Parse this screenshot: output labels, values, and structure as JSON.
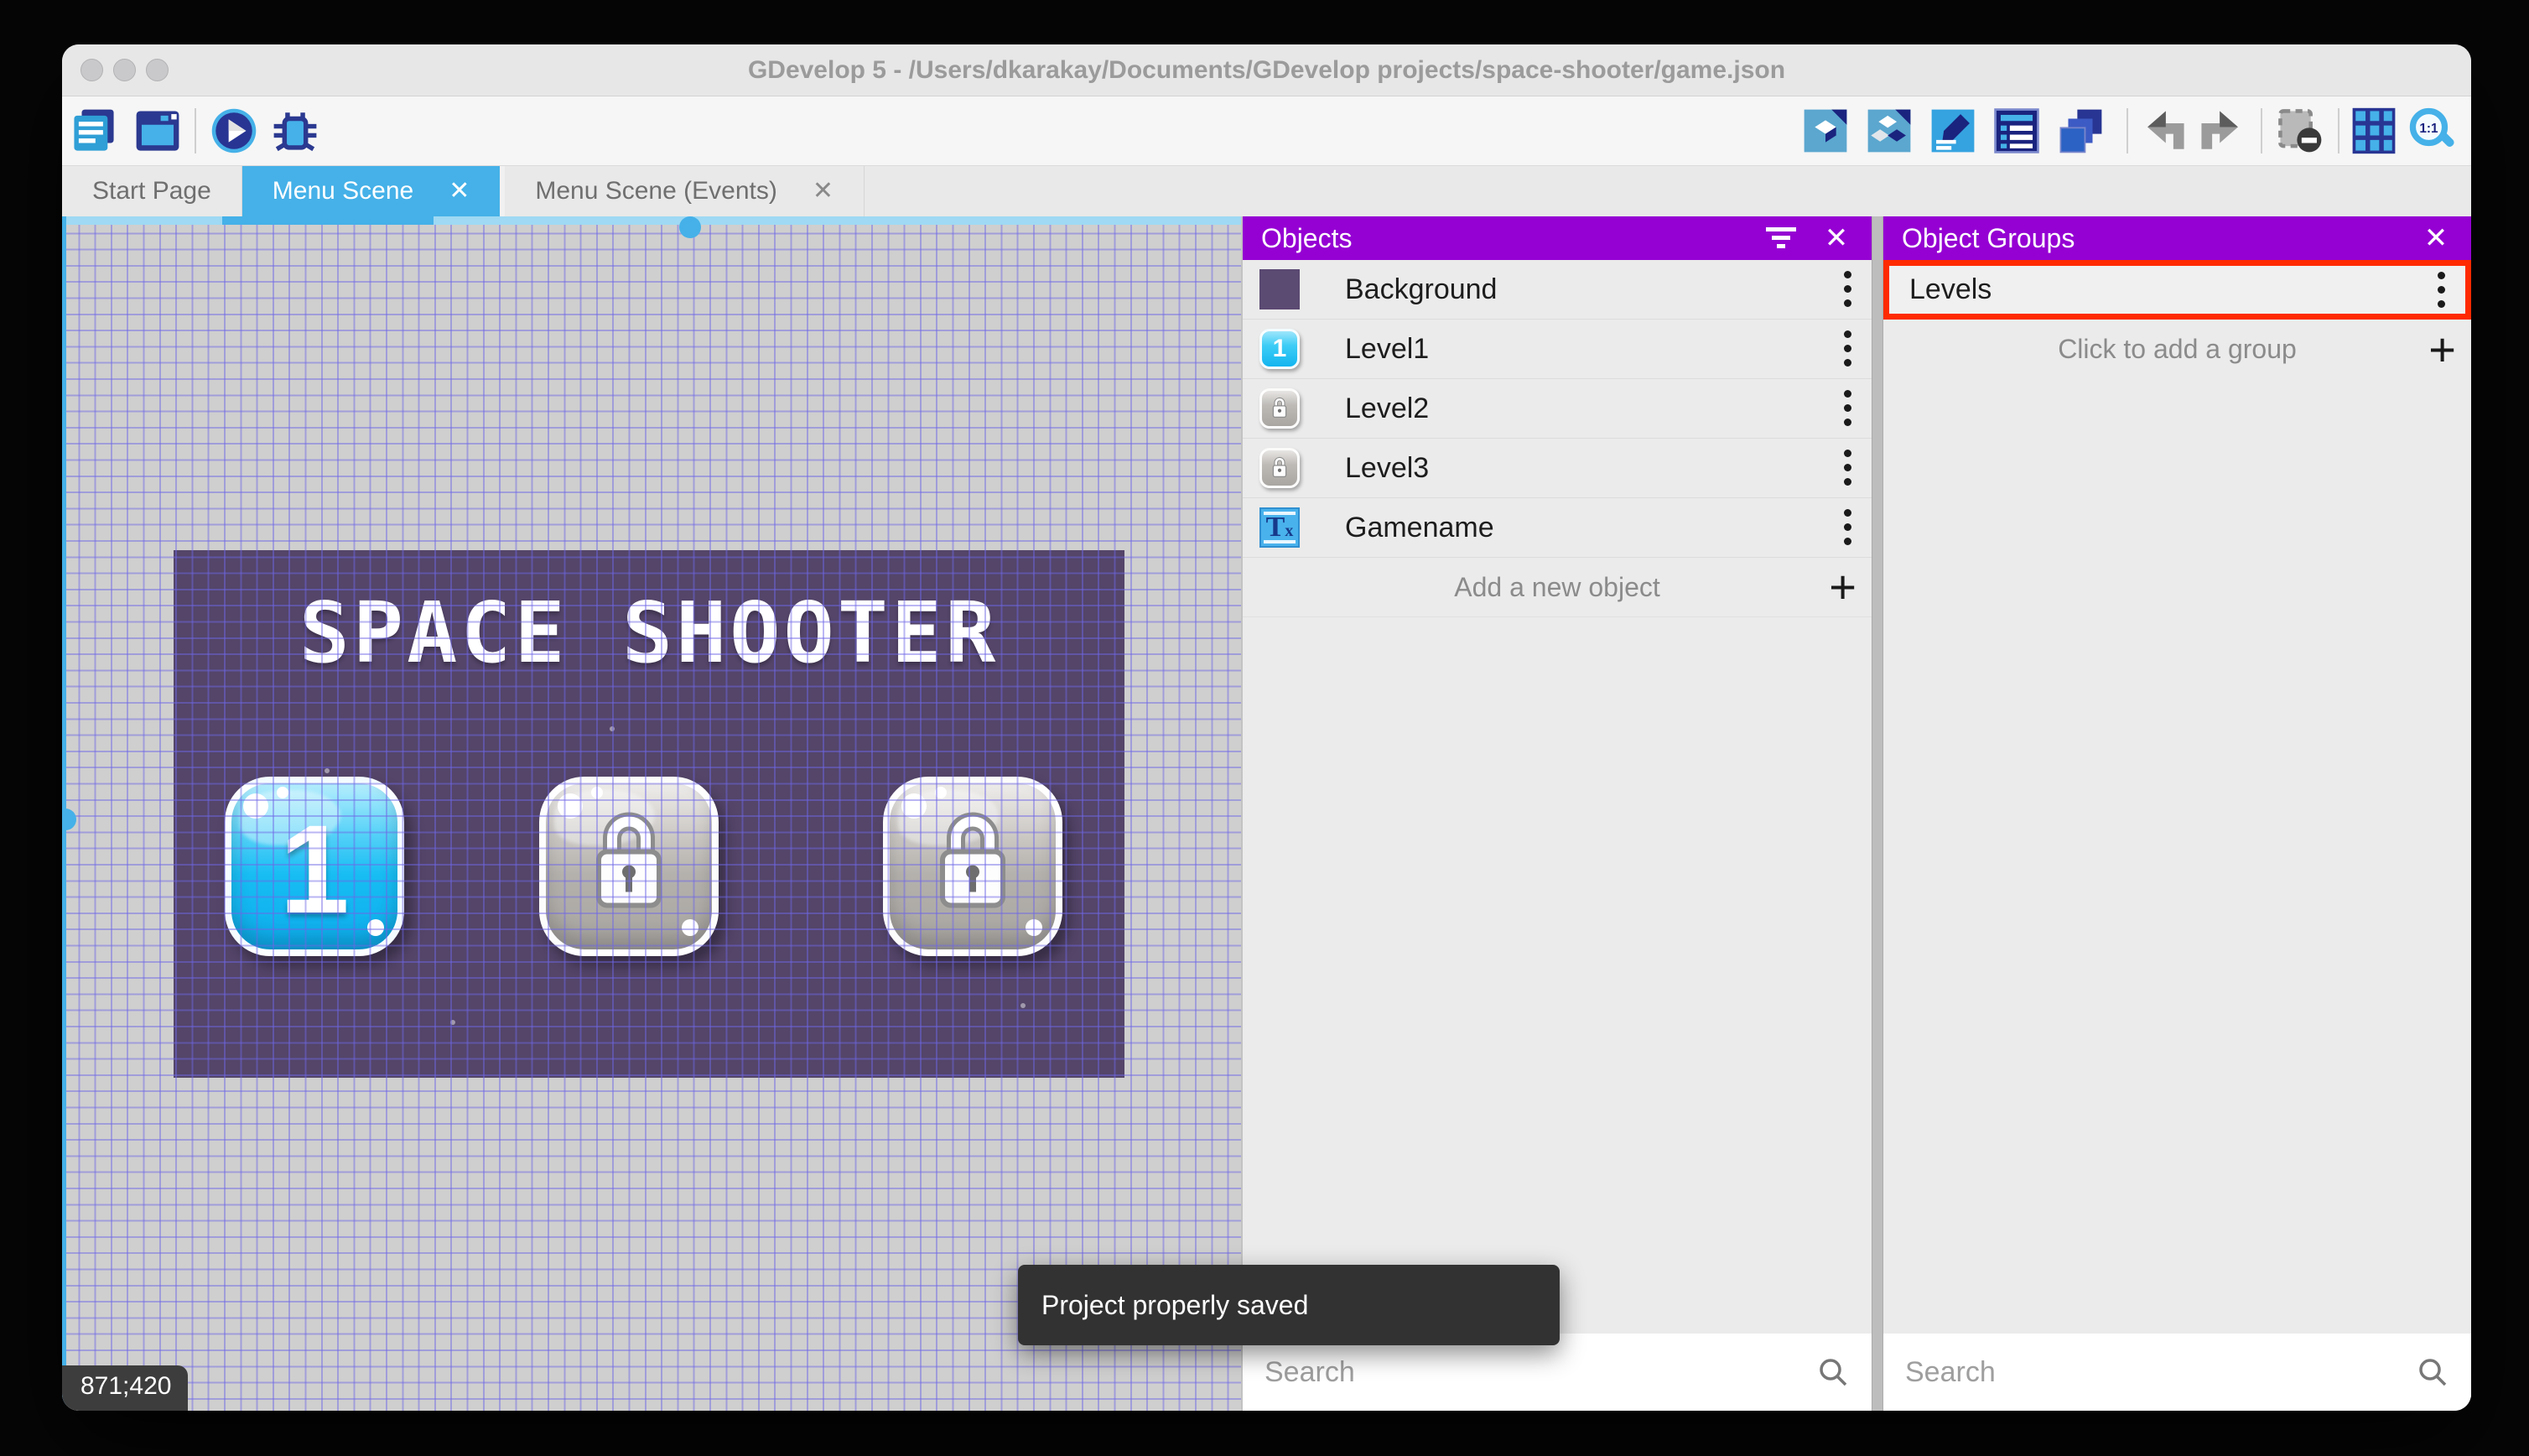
{
  "colors": {
    "accent_purple": "#9501d3",
    "active_tab_blue": "#45b1e8",
    "selection_red": "#ff2a00",
    "game_background_purple": "#544569",
    "toolbar_navy": "#2b3990",
    "toolbar_blue": "#45b1e8"
  },
  "window": {
    "title": "GDevelop 5 - /Users/dkarakay/Documents/GDevelop projects/space-shooter/game.json"
  },
  "toolbar": {
    "left_icons": [
      "project-manager",
      "scene-window",
      "play-preview",
      "debug"
    ],
    "right_icons": [
      "objects-list",
      "object-groups",
      "properties",
      "instances-list",
      "layers",
      "undo",
      "redo",
      "toggle-mask",
      "toggle-grid",
      "zoom-one-to-one"
    ],
    "zoom_label": "1:1"
  },
  "tabs": [
    {
      "label": "Start Page",
      "active": false,
      "closable": false
    },
    {
      "label": "Menu Scene",
      "active": true,
      "closable": true
    },
    {
      "label": "Menu Scene (Events)",
      "active": false,
      "closable": true
    }
  ],
  "scene": {
    "game_title": "SPACE SHOOTER",
    "level_button_label": "1",
    "coordinates": "871;420"
  },
  "objects_panel": {
    "title": "Objects",
    "items": [
      {
        "name": "Background",
        "thumb": "purple-square"
      },
      {
        "name": "Level1",
        "thumb": "blue-button-1"
      },
      {
        "name": "Level2",
        "thumb": "gray-lock-button"
      },
      {
        "name": "Level3",
        "thumb": "gray-lock-button"
      },
      {
        "name": "Gamename",
        "thumb": "text-object"
      }
    ],
    "add_label": "Add a new object",
    "search_placeholder": "Search"
  },
  "groups_panel": {
    "title": "Object Groups",
    "items": [
      {
        "name": "Levels",
        "selected": true
      }
    ],
    "add_label": "Click to add a group",
    "search_placeholder": "Search"
  },
  "toast": {
    "message": "Project properly saved"
  }
}
